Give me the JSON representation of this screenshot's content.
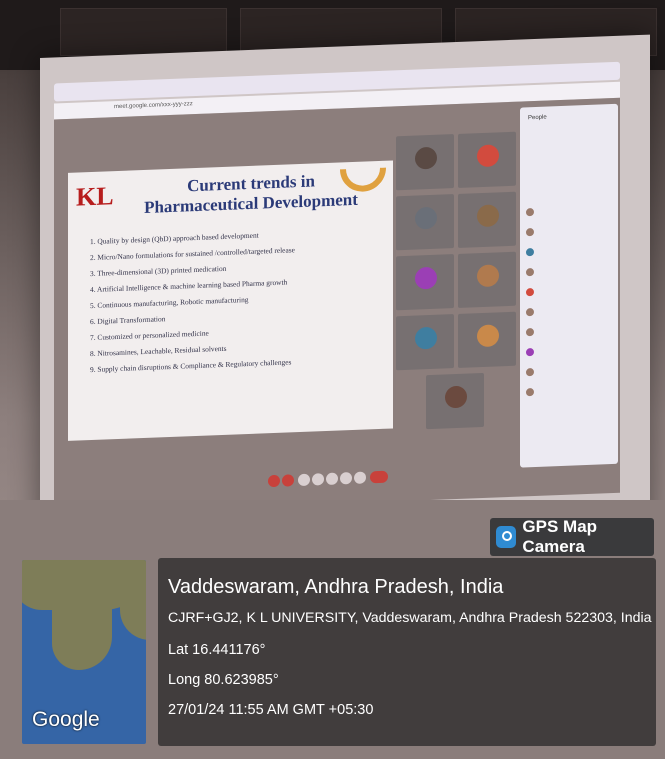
{
  "browser": {
    "address": "meet.google.com/xxx-yyy-zzz"
  },
  "slide": {
    "logo": "KL",
    "title": "Current trends in Pharmaceutical Development",
    "items": [
      "1.  Quality by design (QbD) approach based development",
      "2.  Micro/Nano formulations for sustained /controlled/targeted release",
      "3.  Three-dimensional (3D) printed medication",
      "4.  Artificial Intelligence & machine learning based Pharma growth",
      "5.  Continuous manufacturing, Robotic manufacturing",
      "6.  Digital Transformation",
      "7.  Customized or personalized medicine",
      "8.  Nitrosamines, Leachable, Residual solvents",
      "9.  Supply chain disruptions & Compliance & Regulatory challenges"
    ]
  },
  "people_panel": {
    "title": "People"
  },
  "gps": {
    "badge_label": "GPS Map Camera",
    "place": "Vaddeswaram, Andhra Pradesh, India",
    "address": "CJRF+GJ2, K L UNIVERSITY, Vaddeswaram, Andhra Pradesh 522303, India",
    "lat": "Lat 16.441176°",
    "long": "Long 80.623985°",
    "datetime": "27/01/24 11:55 AM GMT +05:30",
    "map_credit": "Google"
  },
  "colors": {
    "slide_title": "#2b3a78",
    "logo": "#b71d1d",
    "gps_icon": "#2f8bd2"
  }
}
